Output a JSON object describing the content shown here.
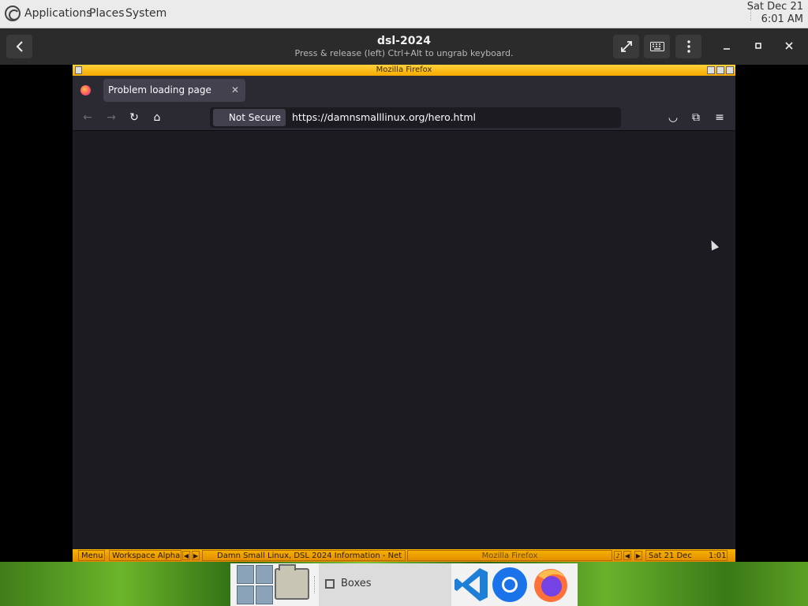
{
  "top_panel": {
    "menus": [
      "Applications",
      "Places",
      "System"
    ],
    "clock_date": "Sat Dec 21",
    "clock_time": "6:01 AM"
  },
  "boxes_header": {
    "title": "dsl-2024",
    "subtitle": "Press & release (left) Ctrl+Alt to ungrab keyboard."
  },
  "guest": {
    "window_title": "Mozilla Firefox",
    "tab_title": "Problem loading page",
    "security_label": "Not Secure",
    "url": "https://damnsmalllinux.org/hero.html"
  },
  "dsl_taskbar": {
    "menu": "Menu",
    "workspace": "Workspace Alpha",
    "task1": "Damn Small Linux, DSL 2024 Information - Net",
    "task2": "Mozilla Firefox",
    "date": "Sat 21 Dec",
    "time": "1:01"
  },
  "dock": {
    "boxes_label": "Boxes"
  },
  "colors": {
    "panel_bg": "#ebebeb",
    "header_bg": "#2b2b2b",
    "firefox_bg": "#1c1b22",
    "dsl_accent": "#f5a800"
  }
}
